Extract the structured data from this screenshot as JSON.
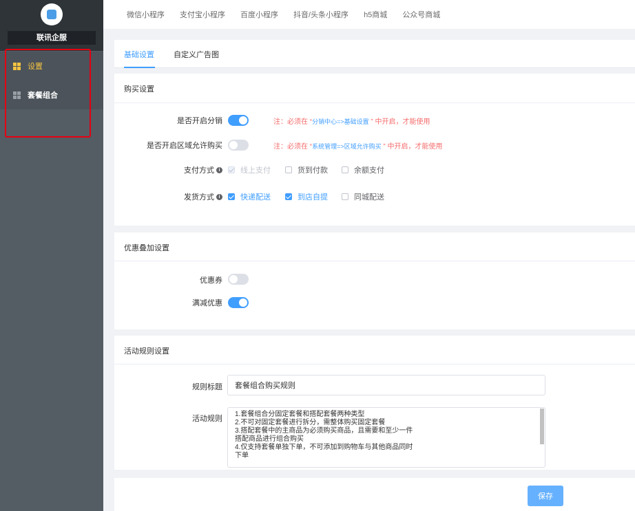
{
  "sidebar": {
    "brand": "联讯企服",
    "items": [
      {
        "label": "设置",
        "active": true
      },
      {
        "label": "套餐组合",
        "active": false
      }
    ]
  },
  "topnav": {
    "items": [
      "微信小程序",
      "支付宝小程序",
      "百度小程序",
      "抖音/头条小程序",
      "h5商城",
      "公众号商城"
    ]
  },
  "tabs": [
    {
      "label": "基础设置",
      "active": true
    },
    {
      "label": "自定义广告图",
      "active": false
    }
  ],
  "purchase": {
    "title": "购买设置",
    "distribution": {
      "label": "是否开启分销",
      "enabled": true,
      "note_prefix": "注：必须在 “",
      "note_link": "分销中心=>基础设置",
      "note_suffix": " ” 中开启，才能使用"
    },
    "region": {
      "label": "是否开启区域允许购买",
      "enabled": false,
      "note_prefix": "注：必须在 “",
      "note_link": "系统管理=>区域允许购买",
      "note_suffix": " ” 中开启，才能使用"
    },
    "payment": {
      "label": "支付方式",
      "options": [
        {
          "label": "线上支付",
          "state": "disabled"
        },
        {
          "label": "货到付款",
          "state": "unchecked"
        },
        {
          "label": "余额支付",
          "state": "unchecked"
        }
      ]
    },
    "delivery": {
      "label": "发货方式",
      "options": [
        {
          "label": "快递配送",
          "state": "checked"
        },
        {
          "label": "到店自提",
          "state": "checked"
        },
        {
          "label": "同城配送",
          "state": "unchecked"
        }
      ]
    }
  },
  "discount": {
    "title": "优惠叠加设置",
    "coupon": {
      "label": "优惠券",
      "enabled": false
    },
    "full_reduction": {
      "label": "满减优惠",
      "enabled": true
    }
  },
  "rules": {
    "title": "活动规则设置",
    "rule_title_label": "规则标题",
    "rule_title_value": "套餐组合购买规则",
    "activity_rules_label": "活动规则",
    "activity_rules_lines": [
      "1.套餐组合分固定套餐和搭配套餐两种类型",
      "2.不可对固定套餐进行拆分，需整体购买固定套餐",
      "3.搭配套餐中的主商品为必须购买商品，且需要和至少一件",
      "搭配商品进行组合购买",
      "4.仅支持套餐单独下单，不可添加到购物车与其他商品同时",
      "下单"
    ]
  },
  "footer": {
    "save_label": "保存"
  },
  "colors": {
    "accent": "#409eff",
    "warning": "#f56c6c",
    "sidebar": "#545c64",
    "active_menu": "#f5c341"
  }
}
